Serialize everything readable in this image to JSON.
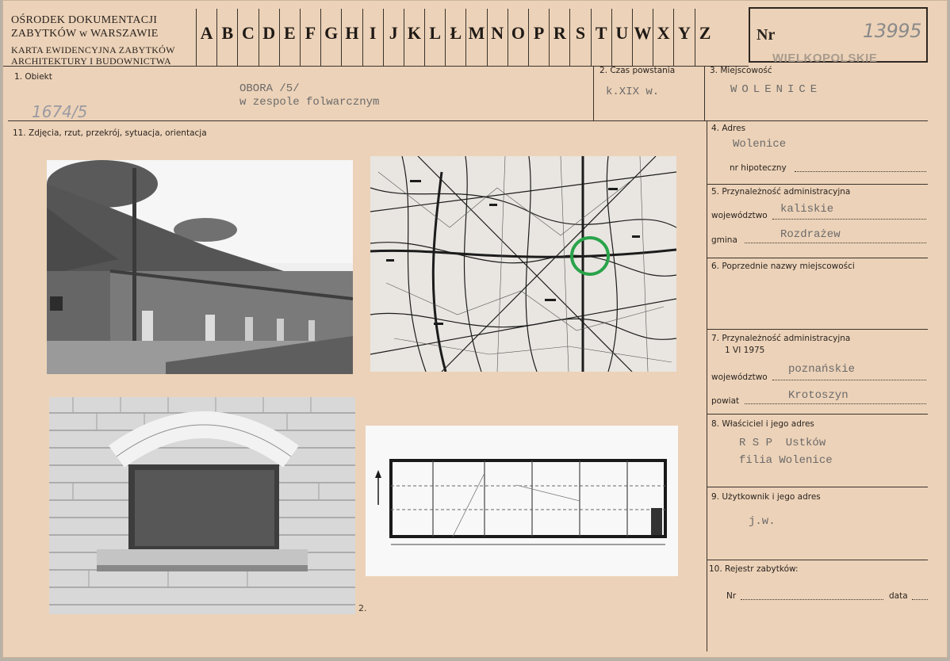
{
  "header": {
    "institution_line1": "OŚRODEK DOKUMENTACJI",
    "institution_line2": "ZABYTKÓW w WARSZAWIE",
    "card_line1": "KARTA EWIDENCYJNA ZABYTKÓW",
    "card_line2": "ARCHITEKTURY I BUDOWNICTWA",
    "letters": [
      "A",
      "B",
      "C",
      "D",
      "E",
      "F",
      "G",
      "H",
      "I",
      "J",
      "K",
      "L",
      "Ł",
      "M",
      "N",
      "O",
      "P",
      "R",
      "S",
      "T",
      "U",
      "W",
      "X",
      "Y",
      "Z"
    ],
    "nr_label": "Nr",
    "nr_value": "13995",
    "stamp": "WIELKOPOLSKIE"
  },
  "fields": {
    "obiekt_label": "1. Obiekt",
    "obiekt_value_1": "OBORA /5/",
    "obiekt_value_2": "w zespole folwarcznym",
    "obiekt_hand": "1674/5",
    "czas_label": "2. Czas powstania",
    "czas_value": "k.XIX w.",
    "miejsc_label": "3. Miejscowość",
    "miejsc_value": "WOLENICE",
    "zdjecia_label": "11. Zdjęcia, rzut, przekrój, sytuacja, orientacja",
    "adres_label": "4. Adres",
    "adres_value": "Wolenice",
    "hipoteczny_label": "nr hipoteczny",
    "przyn5_label": "5. Przynależność administracyjna",
    "woj_label": "województwo",
    "woj_value": "kaliskie",
    "gmina_label": "gmina",
    "gmina_value": "Rozdrażew",
    "poprz_label": "6. Poprzednie nazwy miejscowości",
    "przyn7_label": "7. Przynależność administracyjna",
    "przyn7_date": "1 VI 1975",
    "woj7_label": "województwo",
    "woj7_value": "poznańskie",
    "powiat_label": "powiat",
    "powiat_value": "Krotoszyn",
    "wlasc_label": "8. Właściciel i jego adres",
    "wlasc_value_1": "R S P  Ustków",
    "wlasc_value_2": "filia Wolenice",
    "uzyt_label": "9. Użytkownik i jego adres",
    "uzyt_value": "j.w.",
    "rejestr_label": "10. Rejestr zabytków:",
    "rejestr_nr_label": "Nr",
    "rejestr_data_label": "data",
    "photo_mark": "2."
  },
  "colors": {
    "card": "#ecd2b8",
    "ink": "#2b2520",
    "typed": "#6b6a6a",
    "map_circle": "#2aa34a"
  }
}
